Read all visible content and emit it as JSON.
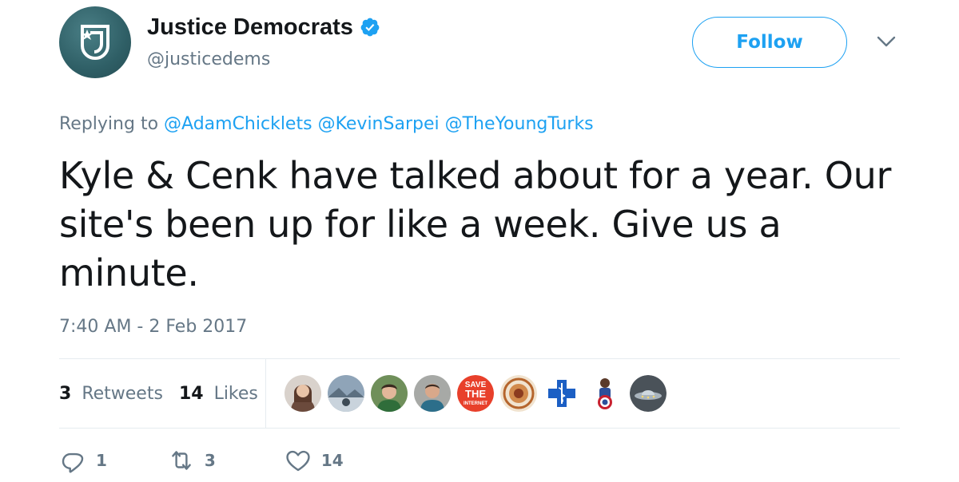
{
  "account": {
    "display_name": "Justice Democrats",
    "handle": "@justicedems",
    "verified": true
  },
  "follow_label": "Follow",
  "reply_context": {
    "prefix": "Replying to",
    "mentions": [
      "@AdamChicklets",
      "@KevinSarpei",
      "@TheYoungTurks"
    ]
  },
  "tweet": {
    "lines": [
      "Kyle & Cenk have talked about for a year. Our",
      "site's been up for like a week. Give us a",
      "minute."
    ],
    "timestamp": "7:40 AM - 2 Feb 2017"
  },
  "stats": {
    "retweets_count": "3",
    "retweets_label": "Retweets",
    "likes_count": "14",
    "likes_label": "Likes"
  },
  "likers": [
    {
      "icon": "person-avatar"
    },
    {
      "icon": "landscape-avatar"
    },
    {
      "icon": "person-avatar"
    },
    {
      "icon": "person-avatar"
    },
    {
      "icon": "save-the-internet-avatar",
      "text": [
        "SAVE",
        "THE",
        "INTERNET"
      ]
    },
    {
      "icon": "seal-avatar"
    },
    {
      "icon": "medical-cross-avatar"
    },
    {
      "icon": "superhero-avatar"
    },
    {
      "icon": "ufo-avatar"
    }
  ],
  "actions": {
    "reply_count": "1",
    "retweet_count": "3",
    "like_count": "14"
  },
  "colors": {
    "accent": "#1da1f2",
    "text": "#14171a",
    "secondary_text": "#657786",
    "divider": "#e6ecf0"
  }
}
